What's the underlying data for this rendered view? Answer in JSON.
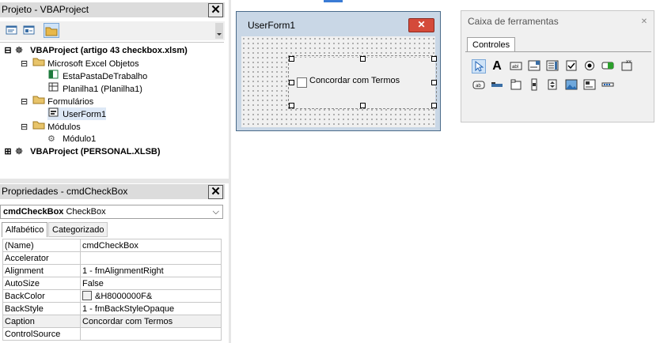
{
  "project_panel": {
    "title": "Projeto - VBAProject",
    "close": "✕",
    "tree": [
      {
        "label": "VBAProject (artigo 43 checkbox.xlsm)",
        "level": 0,
        "bold": true,
        "icon": "vba-project-icon"
      },
      {
        "label": "Microsoft Excel Objetos",
        "level": 1,
        "bold": false,
        "icon": "folder-icon"
      },
      {
        "label": "EstaPastaDeTrabalho",
        "level": 2,
        "bold": false,
        "icon": "excel-workbook-icon"
      },
      {
        "label": "Planilha1 (Planilha1)",
        "level": 2,
        "bold": false,
        "icon": "worksheet-icon"
      },
      {
        "label": "Formulários",
        "level": 1,
        "bold": false,
        "icon": "folder-icon"
      },
      {
        "label": "UserForm1",
        "level": 2,
        "bold": false,
        "icon": "userform-icon"
      },
      {
        "label": "Módulos",
        "level": 1,
        "bold": false,
        "icon": "folder-icon"
      },
      {
        "label": "Módulo1",
        "level": 2,
        "bold": false,
        "icon": "module-icon"
      },
      {
        "label": "VBAProject (PERSONAL.XLSB)",
        "level": 0,
        "bold": true,
        "icon": "vba-project-icon"
      }
    ]
  },
  "properties_panel": {
    "title": "Propriedades - cmdCheckBox",
    "close": "✕",
    "object_name": "cmdCheckBox",
    "object_type": "CheckBox",
    "tabs": [
      "Alfabético",
      "Categorizado"
    ],
    "rows": [
      {
        "name": "(Name)",
        "value": "cmdCheckBox"
      },
      {
        "name": "Accelerator",
        "value": ""
      },
      {
        "name": "Alignment",
        "value": "1 - fmAlignmentRight"
      },
      {
        "name": "AutoSize",
        "value": "False"
      },
      {
        "name": "BackColor",
        "value": "&H8000000F&"
      },
      {
        "name": "BackStyle",
        "value": "1 - fmBackStyleOpaque"
      },
      {
        "name": "Caption",
        "value": "Concordar com Termos"
      },
      {
        "name": "ControlSource",
        "value": ""
      }
    ]
  },
  "userform": {
    "title": "UserForm1",
    "close": "✕",
    "checkbox_caption": "Concordar com Termos"
  },
  "toolbox": {
    "title": "Caixa de ferramentas",
    "close": "✕",
    "tab": "Controles",
    "tools_row1": [
      "select-objects-icon",
      "label-icon",
      "textbox-icon",
      "combobox-icon",
      "listbox-icon",
      "checkbox-icon",
      "optionbutton-icon",
      "togglebutton-icon",
      "frame-icon"
    ],
    "tools_row2": [
      "commandbutton-icon",
      "tabstrip-icon",
      "multipage-icon",
      "scrollbar-icon",
      "spinbutton-icon",
      "image-icon",
      "refedit-icon",
      "other-icon"
    ]
  }
}
